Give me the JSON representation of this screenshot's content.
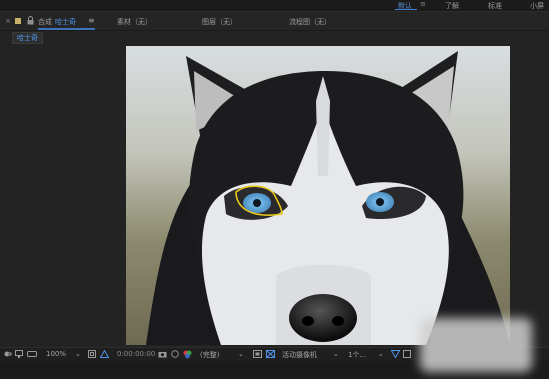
{
  "workspace": {
    "items": [
      "默认",
      "了解",
      "标准",
      "小屏"
    ],
    "active_index": 0,
    "more_label": "≡"
  },
  "panel": {
    "close_label": "×",
    "title_prefix": "合成",
    "comp_name": "哈士奇",
    "menu_label": "≡",
    "tabs": [
      "素材（无）",
      "图层（无）",
      "流程图（无）"
    ],
    "label_color": "#c9b26c",
    "accent_color": "#4f94e8"
  },
  "subtab": {
    "label": "哈士奇"
  },
  "viewer": {
    "image_alt": "husky dog photo with yellow selection around left eye"
  },
  "toolbar": {
    "zoom": "100%",
    "timecode": "0:00:00:00",
    "resolution": "(完整)",
    "camera": "活动摄像机",
    "views": "1个..."
  }
}
